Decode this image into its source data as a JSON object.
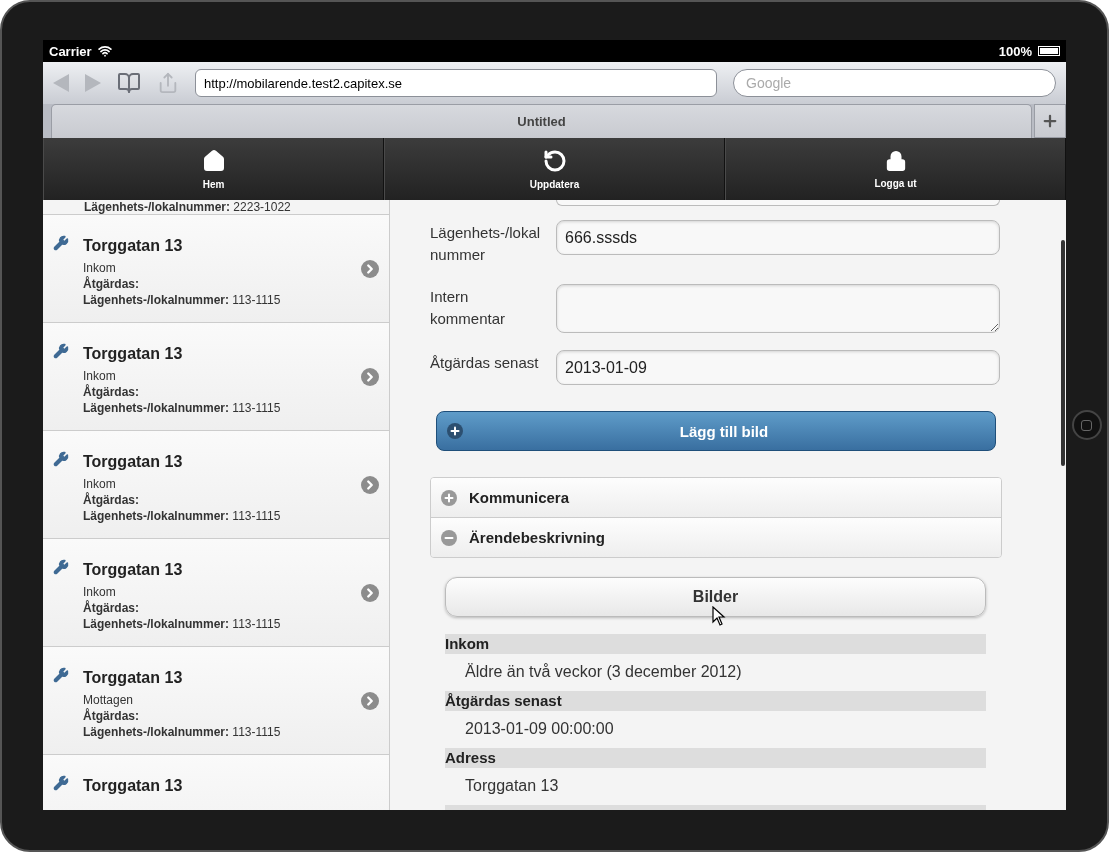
{
  "status_bar": {
    "carrier": "Carrier",
    "battery": "100%"
  },
  "browser": {
    "url": "http://mobilarende.test2.capitex.se",
    "search_placeholder": "Google",
    "tab_title": "Untitled",
    "back_disabled": true,
    "forward_disabled": true
  },
  "nav": [
    {
      "label": "Hem"
    },
    {
      "label": "Uppdatera"
    },
    {
      "label": "Logga ut"
    }
  ],
  "list": {
    "partial_line": "**Lägenhets-/lokalnummer:** 2223-1022",
    "items": [
      {
        "title": "Torggatan 13",
        "status": "Inkom",
        "due_label": "Åtgärdas:",
        "unit": "**Lägenhets-/lokalnummer:** 113-1115"
      },
      {
        "title": "Torggatan 13",
        "status": "Inkom",
        "due_label": "Åtgärdas:",
        "unit": "**Lägenhets-/lokalnummer:** 113-1115"
      },
      {
        "title": "Torggatan 13",
        "status": "Inkom",
        "due_label": "Åtgärdas:",
        "unit": "**Lägenhets-/lokalnummer:** 113-1115"
      },
      {
        "title": "Torggatan 13",
        "status": "Inkom",
        "due_label": "Åtgärdas:",
        "unit": "**Lägenhets-/lokalnummer:** 113-1115"
      },
      {
        "title": "Torggatan 13",
        "status": "Mottagen",
        "due_label": "Åtgärdas:",
        "unit": "**Lägenhets-/lokalnummer:** 113-1115"
      }
    ],
    "last_title": "Torggatan 13"
  },
  "form": [
    {
      "kind": "input",
      "label": "Lägenhets-/lokalnummer",
      "value": "666.sssds"
    },
    {
      "kind": "textarea",
      "label": "Intern kommentar"
    },
    {
      "kind": "input",
      "label": "Åtgärdas senast",
      "value": "2013-01-09"
    }
  ],
  "add_image_button": "Lägg till bild",
  "collapsibles": [
    {
      "title": "Kommunicera",
      "expanded": false
    },
    {
      "title": "Ärendebeskrivning",
      "expanded": true
    }
  ],
  "images_button": "Bilder",
  "details": [
    {
      "heading": "Inkom",
      "value": "Äldre än två veckor (3 december 2012)"
    },
    {
      "heading": "Åtgärdas senast",
      "value": "2013-01-09 00:00:00"
    },
    {
      "heading": "Adress",
      "value": "Torggatan 13"
    }
  ]
}
